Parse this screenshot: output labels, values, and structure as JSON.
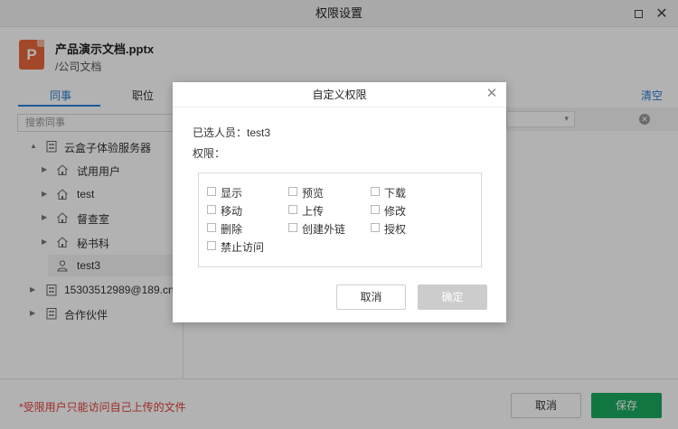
{
  "window": {
    "title": "权限设置"
  },
  "file": {
    "name": "产品演示文档.pptx",
    "path": "/公司文档",
    "icon_letter": "P"
  },
  "tabs": [
    {
      "label": "同事"
    },
    {
      "label": "职位"
    }
  ],
  "search": {
    "placeholder": "搜索同事"
  },
  "tree": [
    {
      "label": "云盒子体验服务器",
      "icon": "building-icon",
      "expanded": true
    },
    {
      "label": "试用用户",
      "icon": "home-icon"
    },
    {
      "label": "test",
      "icon": "home-icon"
    },
    {
      "label": "督查室",
      "icon": "home-icon"
    },
    {
      "label": "秘书科",
      "icon": "home-icon"
    },
    {
      "label": "test3",
      "icon": "user-icon",
      "selected": true
    },
    {
      "label": "15303512989@189.cn",
      "icon": "building-icon"
    },
    {
      "label": "合作伙伴",
      "icon": "building-icon"
    }
  ],
  "right": {
    "clear_label": "清空"
  },
  "footer": {
    "note": "*受限用户只能访问自己上传的文件",
    "cancel_label": "取消",
    "save_label": "保存"
  },
  "dialog": {
    "title": "自定义权限",
    "selected_text": "已选人员：test3",
    "perm_label": "权限：",
    "permissions": [
      {
        "label": "显示",
        "checked": false
      },
      {
        "label": "预览",
        "checked": false
      },
      {
        "label": "下载",
        "checked": false
      },
      {
        "label": "移动",
        "checked": false
      },
      {
        "label": "上传",
        "checked": false
      },
      {
        "label": "修改",
        "checked": false
      },
      {
        "label": "删除",
        "checked": false
      },
      {
        "label": "创建外链",
        "checked": false
      },
      {
        "label": "授权",
        "checked": false
      },
      {
        "label": "禁止访问",
        "checked": false
      }
    ],
    "cancel_label": "取消",
    "ok_label": "确定"
  },
  "colors": {
    "accent_blue": "#2a7fd4",
    "save_green": "#1aaa60",
    "warning_red": "#e0403a",
    "ppt_orange": "#e8683a",
    "disabled_gray": "#cccccc"
  }
}
